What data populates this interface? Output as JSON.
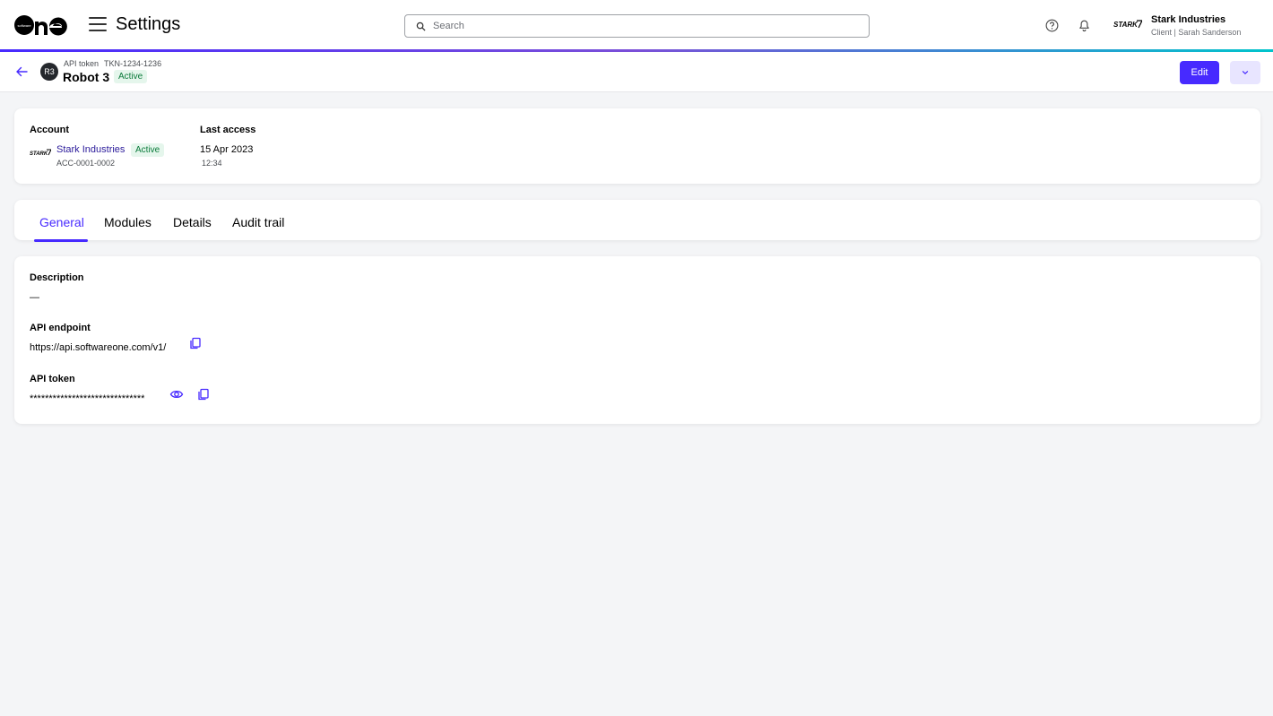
{
  "topbar": {
    "app_title": "Settings",
    "search_placeholder": "Search",
    "account_name": "Stark Industries",
    "account_sub": "Client | Sarah Sanderson"
  },
  "header": {
    "breadcrumb_type": "API token",
    "breadcrumb_id": "TKN-1234-1236",
    "avatar_initials": "R3",
    "title": "Robot 3",
    "status": "Active",
    "edit_label": "Edit"
  },
  "summary": {
    "account_label": "Account",
    "account_name": "Stark Industries",
    "account_status": "Active",
    "account_id": "ACC-0001-0002",
    "last_access_label": "Last access",
    "last_access_date": "15 Apr 2023",
    "last_access_time": "12:34"
  },
  "tabs": [
    {
      "label": "General",
      "active": true
    },
    {
      "label": "Modules",
      "active": false
    },
    {
      "label": "Details",
      "active": false
    },
    {
      "label": "Audit trail",
      "active": false
    }
  ],
  "general": {
    "description_label": "Description",
    "description_value": "—",
    "endpoint_label": "API endpoint",
    "endpoint_value": "https://api.softwareone.com/v1/",
    "token_label": "API token",
    "token_value": "******************************"
  },
  "colors": {
    "accent": "#472aff",
    "active_bg": "#e5f6ec",
    "active_text": "#0a7a3a"
  }
}
